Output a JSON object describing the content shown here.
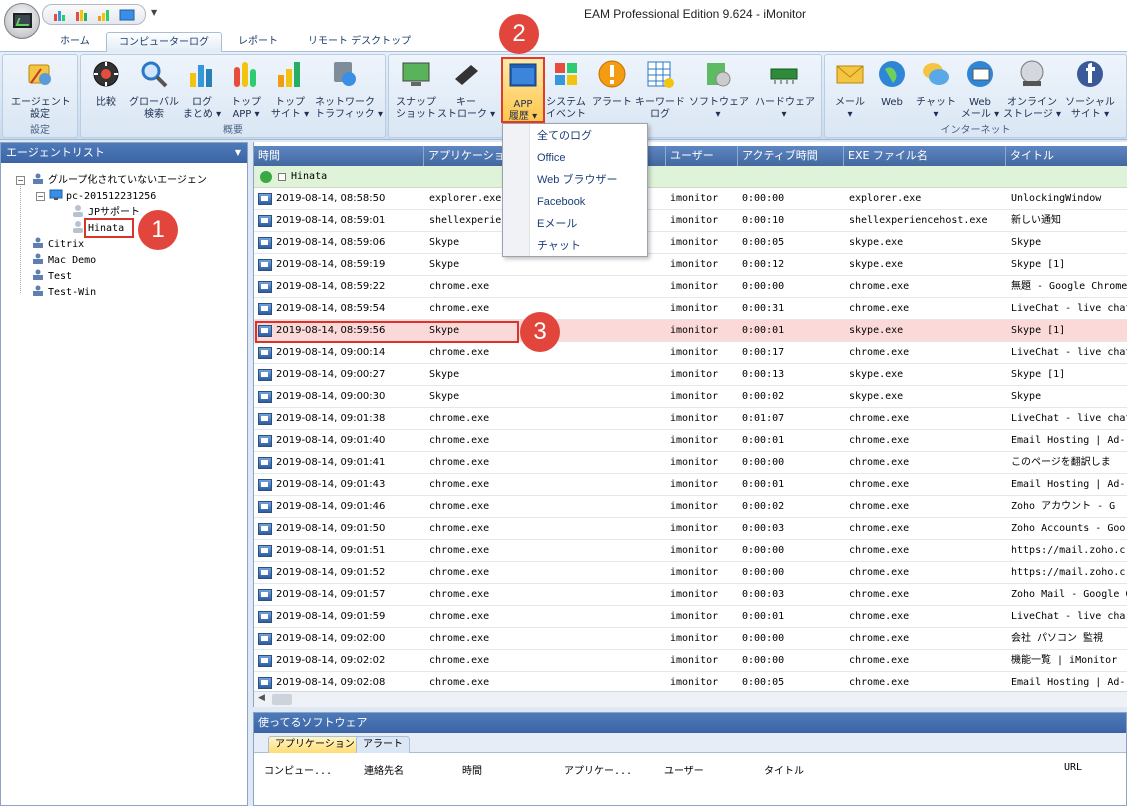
{
  "window": {
    "title": "EAM Professional Edition 9.624 - iMonitor"
  },
  "tabs": [
    {
      "label": "ホーム"
    },
    {
      "label": "コンピューターログ"
    },
    {
      "label": "レポート"
    },
    {
      "label": "リモート デスクトップ"
    }
  ],
  "ribbon": {
    "groups": [
      {
        "label": "設定"
      },
      {
        "label": "概要"
      },
      {
        "label": ""
      },
      {
        "label": "インターネット"
      }
    ],
    "buttons": [
      {
        "label": "エージェント\n設定"
      },
      {
        "label": "比較"
      },
      {
        "label": "グローバル\n検索"
      },
      {
        "label": "ログ\nまとめ ▾"
      },
      {
        "label": "トップ\nAPP ▾"
      },
      {
        "label": "トップ\nサイト ▾"
      },
      {
        "label": "ネットワーク\nトラフィック ▾"
      },
      {
        "label": "スナップ\nショット"
      },
      {
        "label": "キー\nストローク ▾"
      },
      {
        "label": "APP\n履歴 ▾"
      },
      {
        "label": "システム\nイベント"
      },
      {
        "label": "アラート"
      },
      {
        "label": "キーワード\nログ"
      },
      {
        "label": "ソフトウェア\n▾"
      },
      {
        "label": "ハードウェア\n▾"
      },
      {
        "label": "メール\n▾"
      },
      {
        "label": "Web"
      },
      {
        "label": "チャット\n▾"
      },
      {
        "label": "Web\nメール ▾"
      },
      {
        "label": "オンライン\nストレージ ▾"
      },
      {
        "label": "ソーシャル\nサイト ▾"
      }
    ]
  },
  "dropdown": {
    "items": [
      {
        "label": "全てのログ"
      },
      {
        "label": "Office"
      },
      {
        "label": "Web ブラウザー"
      },
      {
        "label": "Facebook"
      },
      {
        "label": "Eメール"
      },
      {
        "label": "チャット"
      }
    ]
  },
  "agent_list": {
    "title": "エージェントリスト",
    "nodes": [
      {
        "label": "グループ化されていないエージェン"
      },
      {
        "label": "pc-201512231256"
      },
      {
        "label": "JPサポート"
      },
      {
        "label": "Hinata"
      },
      {
        "label": "Citrix"
      },
      {
        "label": "Mac Demo"
      },
      {
        "label": "Test"
      },
      {
        "label": "Test-Win"
      }
    ]
  },
  "grid": {
    "columns": [
      {
        "label": "時間"
      },
      {
        "label": "アプリケーション"
      },
      {
        "label": "ユーザー"
      },
      {
        "label": "アクティブ時間"
      },
      {
        "label": "EXE ファイル名"
      },
      {
        "label": "タイトル"
      }
    ],
    "group_label": "Hinata",
    "rows": [
      {
        "time": "2019-08-14, 08:58:50",
        "app": "explorer.exe",
        "user": "imonitor",
        "active": "0:00:00",
        "exe": "explorer.exe",
        "title": "UnlockingWindow"
      },
      {
        "time": "2019-08-14, 08:59:01",
        "app": "shellexperiencehost.exe",
        "user": "imonitor",
        "active": "0:00:10",
        "exe": "shellexperiencehost.exe",
        "title": "新しい通知"
      },
      {
        "time": "2019-08-14, 08:59:06",
        "app": "Skype",
        "user": "imonitor",
        "active": "0:00:05",
        "exe": "skype.exe",
        "title": "Skype"
      },
      {
        "time": "2019-08-14, 08:59:19",
        "app": "Skype",
        "user": "imonitor",
        "active": "0:00:12",
        "exe": "skype.exe",
        "title": "Skype [1]"
      },
      {
        "time": "2019-08-14, 08:59:22",
        "app": "chrome.exe",
        "user": "imonitor",
        "active": "0:00:00",
        "exe": "chrome.exe",
        "title": "無題 - Google Chrome"
      },
      {
        "time": "2019-08-14, 08:59:54",
        "app": "chrome.exe",
        "user": "imonitor",
        "active": "0:00:31",
        "exe": "chrome.exe",
        "title": "LiveChat - live chat"
      },
      {
        "time": "2019-08-14, 08:59:56",
        "app": "Skype",
        "user": "imonitor",
        "active": "0:00:01",
        "exe": "skype.exe",
        "title": "Skype [1]"
      },
      {
        "time": "2019-08-14, 09:00:14",
        "app": "chrome.exe",
        "user": "imonitor",
        "active": "0:00:17",
        "exe": "chrome.exe",
        "title": "LiveChat - live chat"
      },
      {
        "time": "2019-08-14, 09:00:27",
        "app": "Skype",
        "user": "imonitor",
        "active": "0:00:13",
        "exe": "skype.exe",
        "title": "Skype [1]"
      },
      {
        "time": "2019-08-14, 09:00:30",
        "app": "Skype",
        "user": "imonitor",
        "active": "0:00:02",
        "exe": "skype.exe",
        "title": "Skype"
      },
      {
        "time": "2019-08-14, 09:01:38",
        "app": "chrome.exe",
        "user": "imonitor",
        "active": "0:01:07",
        "exe": "chrome.exe",
        "title": "LiveChat - live chat"
      },
      {
        "time": "2019-08-14, 09:01:40",
        "app": "chrome.exe",
        "user": "imonitor",
        "active": "0:00:01",
        "exe": "chrome.exe",
        "title": "Email Hosting | Ad-"
      },
      {
        "time": "2019-08-14, 09:01:41",
        "app": "chrome.exe",
        "user": "imonitor",
        "active": "0:00:00",
        "exe": "chrome.exe",
        "title": "このページを翻訳しま"
      },
      {
        "time": "2019-08-14, 09:01:43",
        "app": "chrome.exe",
        "user": "imonitor",
        "active": "0:00:01",
        "exe": "chrome.exe",
        "title": "Email Hosting | Ad-"
      },
      {
        "time": "2019-08-14, 09:01:46",
        "app": "chrome.exe",
        "user": "imonitor",
        "active": "0:00:02",
        "exe": "chrome.exe",
        "title": "Zoho アカウント - G"
      },
      {
        "time": "2019-08-14, 09:01:50",
        "app": "chrome.exe",
        "user": "imonitor",
        "active": "0:00:03",
        "exe": "chrome.exe",
        "title": "Zoho Accounts - Goo"
      },
      {
        "time": "2019-08-14, 09:01:51",
        "app": "chrome.exe",
        "user": "imonitor",
        "active": "0:00:00",
        "exe": "chrome.exe",
        "title": "https://mail.zoho.c"
      },
      {
        "time": "2019-08-14, 09:01:52",
        "app": "chrome.exe",
        "user": "imonitor",
        "active": "0:00:00",
        "exe": "chrome.exe",
        "title": "https://mail.zoho.c"
      },
      {
        "time": "2019-08-14, 09:01:57",
        "app": "chrome.exe",
        "user": "imonitor",
        "active": "0:00:03",
        "exe": "chrome.exe",
        "title": "Zoho Mail - Google C"
      },
      {
        "time": "2019-08-14, 09:01:59",
        "app": "chrome.exe",
        "user": "imonitor",
        "active": "0:00:01",
        "exe": "chrome.exe",
        "title": "LiveChat - live cha"
      },
      {
        "time": "2019-08-14, 09:02:00",
        "app": "chrome.exe",
        "user": "imonitor",
        "active": "0:00:00",
        "exe": "chrome.exe",
        "title": "会社 パソコン 監視"
      },
      {
        "time": "2019-08-14, 09:02:02",
        "app": "chrome.exe",
        "user": "imonitor",
        "active": "0:00:00",
        "exe": "chrome.exe",
        "title": "機能一覧 | iMonitor"
      },
      {
        "time": "2019-08-14, 09:02:08",
        "app": "chrome.exe",
        "user": "imonitor",
        "active": "0:00:05",
        "exe": "chrome.exe",
        "title": "Email Hosting | Ad-"
      }
    ]
  },
  "bottom_panel": {
    "title": "使ってるソフトウェア",
    "tabs": [
      {
        "label": "アプリケーション"
      },
      {
        "label": "アラート"
      }
    ],
    "columns": [
      {
        "label": "コンピュー..."
      },
      {
        "label": "連絡先名"
      },
      {
        "label": "時間"
      },
      {
        "label": "アプリケー..."
      },
      {
        "label": "ユーザー"
      },
      {
        "label": "タイトル"
      },
      {
        "label": "URL"
      }
    ]
  },
  "callouts": [
    {
      "label": "1"
    },
    {
      "label": "2"
    },
    {
      "label": "3"
    }
  ]
}
